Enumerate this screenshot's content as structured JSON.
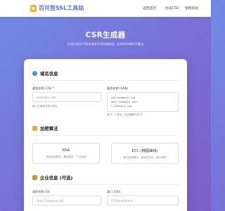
{
  "nav": {
    "brand": "百可签SSL工具站",
    "links": [
      "返回首页",
      "生成CSR",
      "使用帮助"
    ]
  },
  "hero": {
    "title": "CSR生成器",
    "subtitle": "在线生成证书签名请求(CSR)和私钥，支持RSA和ECC算法"
  },
  "sections": {
    "domain": {
      "icon": "globe-icon",
      "title": "域名信息",
      "common_name_label": "通用名称 (CN) *",
      "common_name_placeholder": "example.com",
      "common_name_hint": "输入主要域名或IP地址",
      "san_label": "备用名称 (SAN)",
      "san_lines": [
        "www.example.com",
        "mail.example.com",
        "*.example.com"
      ],
      "san_hint": "每行一个域名，支持通配符证书"
    },
    "algorithm": {
      "icon": "lock-icon",
      "title": "加密算法",
      "options": [
        {
          "name": "RSA",
          "desc": "传统加密算法，兼容性好，广泛支持"
        },
        {
          "name": "ECC (椭圆曲线)",
          "desc": "现代加密算法，更高安全性，更小体积"
        }
      ]
    },
    "org": {
      "icon": "building-icon",
      "title": "企业信息 (可选)",
      "org_label": "组织名称 (O)",
      "org_placeholder": "Your Company Ltd",
      "unit_label": "部门 (OU)",
      "unit_placeholder": "IT Department"
    }
  },
  "colors": {
    "accent": "#5b6fd8",
    "brand_icon": "#ffb020",
    "gradient_start": "#6f8be6",
    "gradient_end": "#7b5fc4"
  }
}
